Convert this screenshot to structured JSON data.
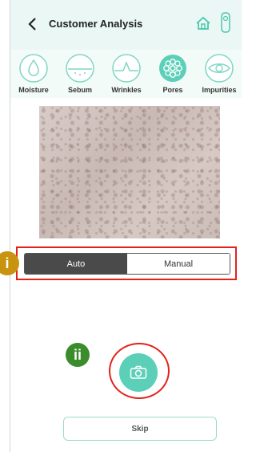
{
  "header": {
    "title": "Customer Analysis"
  },
  "tabs": [
    {
      "label": "Moisture",
      "icon": "water-drop-icon"
    },
    {
      "label": "Sebum",
      "icon": "sebum-icon"
    },
    {
      "label": "Wrinkles",
      "icon": "wrinkles-icon"
    },
    {
      "label": "Pores",
      "icon": "pores-icon",
      "selected": true
    },
    {
      "label": "Impurities",
      "icon": "impurities-icon"
    }
  ],
  "mode": {
    "auto_label": "Auto",
    "manual_label": "Manual",
    "selected": "Auto"
  },
  "annotations": {
    "badge_i": "i",
    "badge_ii": "ii"
  },
  "skip_label": "Skip",
  "colors": {
    "accent": "#5ccfb8",
    "header_bg": "#eaf7f4",
    "highlight": "#e2231a"
  }
}
